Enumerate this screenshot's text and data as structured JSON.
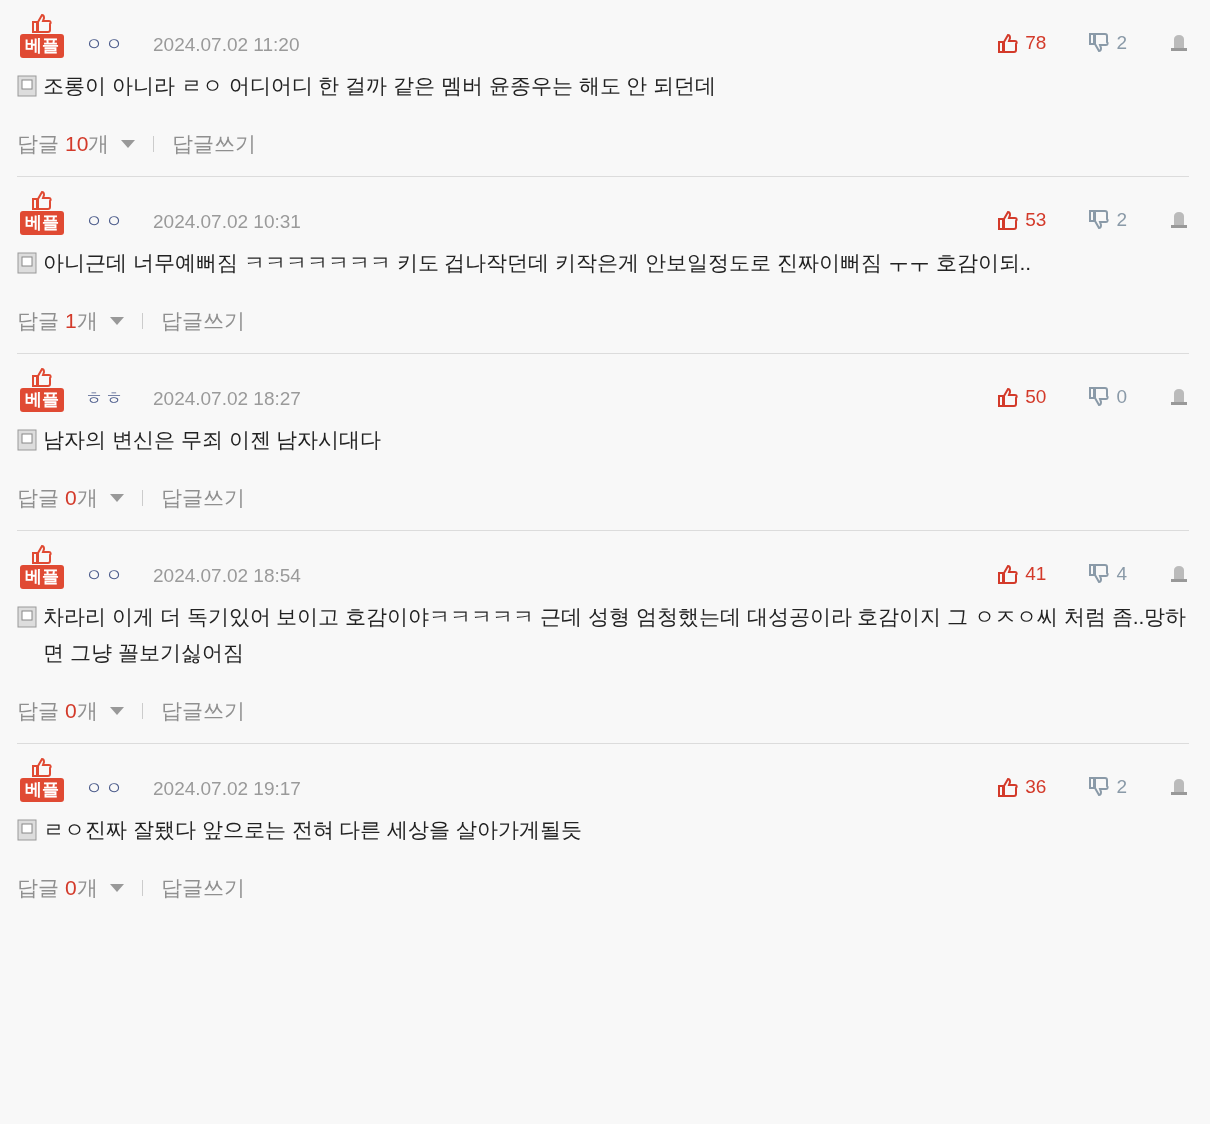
{
  "comments": [
    {
      "badge": "베플",
      "author": "ㅇㅇ",
      "date": "2024.07.02 11:20",
      "likes": "78",
      "dislikes": "2",
      "text": "조롱이 아니라 ㄹㅇ 어디어디 한 걸까 같은 멤버 윤종우는 해도 안 되던데",
      "reply_label": "답글",
      "reply_count": "10",
      "reply_unit": "개",
      "reply_write": "답글쓰기"
    },
    {
      "badge": "베플",
      "author": "ㅇㅇ",
      "date": "2024.07.02 10:31",
      "likes": "53",
      "dislikes": "2",
      "text": "아니근데 너무예뻐짐 ㅋㅋㅋㅋㅋㅋㅋ 키도 겁나작던데 키작은게 안보일정도로 진짜이뻐짐 ㅜㅜ 호감이되..",
      "reply_label": "답글",
      "reply_count": "1",
      "reply_unit": "개",
      "reply_write": "답글쓰기"
    },
    {
      "badge": "베플",
      "author": "ㅎㅎ",
      "date": "2024.07.02 18:27",
      "likes": "50",
      "dislikes": "0",
      "text": "남자의 변신은 무죄 이젠 남자시대다",
      "reply_label": "답글",
      "reply_count": "0",
      "reply_unit": "개",
      "reply_write": "답글쓰기"
    },
    {
      "badge": "베플",
      "author": "ㅇㅇ",
      "date": "2024.07.02 18:54",
      "likes": "41",
      "dislikes": "4",
      "text": "차라리 이게 더 독기있어 보이고 호감이야ㅋㅋㅋㅋㅋ 근데 성형 엄청했는데 대성공이라 호감이지 그 ㅇㅈㅇ씨 처럼 좀..망하면 그냥 꼴보기싫어짐",
      "reply_label": "답글",
      "reply_count": "0",
      "reply_unit": "개",
      "reply_write": "답글쓰기"
    },
    {
      "badge": "베플",
      "author": "ㅇㅇ",
      "date": "2024.07.02 19:17",
      "likes": "36",
      "dislikes": "2",
      "text": "ㄹㅇ진짜 잘됐다 앞으로는 전혀 다른 세상을 살아가게될듯",
      "reply_label": "답글",
      "reply_count": "0",
      "reply_unit": "개",
      "reply_write": "답글쓰기"
    }
  ]
}
